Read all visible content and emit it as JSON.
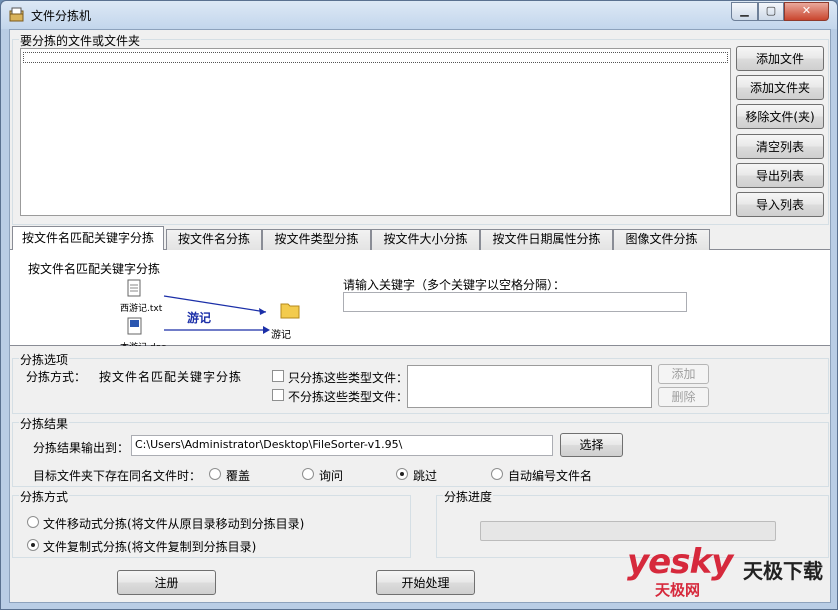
{
  "window": {
    "title": "文件分拣机"
  },
  "file_group": {
    "title": "要分拣的文件或文件夹",
    "buttons": [
      "添加文件",
      "添加文件夹",
      "移除文件(夹)",
      "清空列表",
      "导出列表",
      "导入列表"
    ]
  },
  "tabs": [
    {
      "label": "按文件名匹配关键字分拣",
      "active": true
    },
    {
      "label": "按文件名分拣",
      "active": false
    },
    {
      "label": "按文件类型分拣",
      "active": false
    },
    {
      "label": "按文件大小分拣",
      "active": false
    },
    {
      "label": "按文件日期属性分拣",
      "active": false
    },
    {
      "label": "图像文件分拣",
      "active": false
    }
  ],
  "tab_panel": {
    "heading": "按文件名匹配关键字分拣",
    "diagram": {
      "file1": "西游记.txt",
      "file2": "本游记.doc",
      "keyword": "游记",
      "folder": "游记"
    },
    "keyword_label": "请输入关键字（多个关键字以空格分隔）：",
    "keyword_value": ""
  },
  "options": {
    "title": "分拣选项",
    "method_label": "分拣方式：",
    "method_value": "按文件名匹配关键字分拣",
    "only_types_label": "只分拣这些类型文件：",
    "exclude_types_label": "不分拣这些类型文件：",
    "add_label": "添加",
    "delete_label": "删除"
  },
  "result": {
    "title": "分拣结果",
    "output_label": "分拣结果输出到：",
    "output_path": "C:\\Users\\Administrator\\Desktop\\FileSorter-v1.95\\",
    "choose_label": "选择",
    "conflict_label": "目标文件夹下存在同名文件时：",
    "conflict_options": [
      "覆盖",
      "询问",
      "跳过",
      "自动编号文件名"
    ],
    "conflict_selected": "跳过"
  },
  "mode": {
    "title": "分拣方式",
    "options": [
      "文件移动式分拣(将文件从原目录移动到分拣目录)",
      "文件复制式分拣(将文件复制到分拣目录)"
    ],
    "selected": "文件复制式分拣(将文件复制到分拣目录)"
  },
  "progress": {
    "title": "分拣进度",
    "value": 0
  },
  "bottom": {
    "register_label": "注册",
    "start_label": "开始处理"
  },
  "watermark": {
    "logo": "yesky",
    "brand": "天极下载",
    "sub": "天极网"
  }
}
